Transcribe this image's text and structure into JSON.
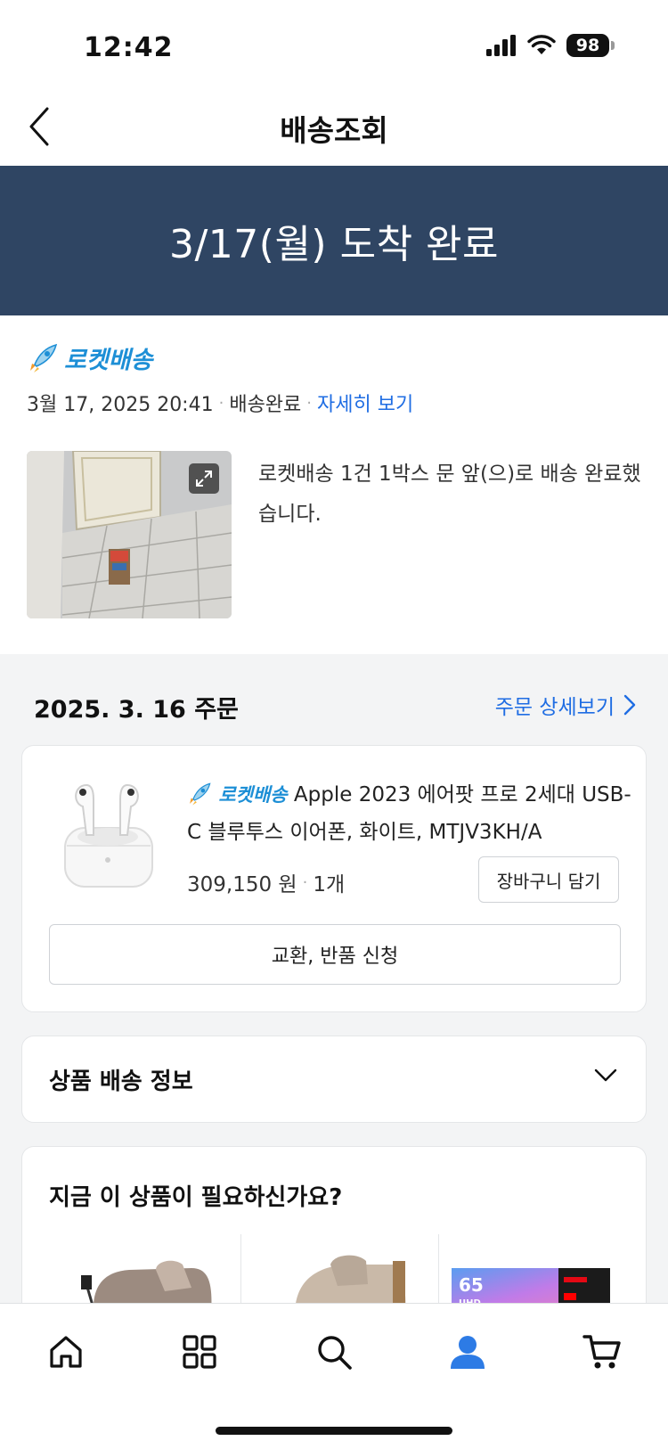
{
  "status_bar": {
    "time": "12:42",
    "battery": "98"
  },
  "header": {
    "title": "배송조회"
  },
  "banner": {
    "arrival": "3/17(월) 도착 완료"
  },
  "delivery": {
    "brand": "로켓배송",
    "datetime": "3월 17, 2025 20:41",
    "status": "배송완료",
    "detail_link": "자세히 보기",
    "message": "로켓배송 1건 1박스 문 앞(으)로 배송 완료했습니다."
  },
  "order": {
    "date": "2025. 3. 16 주문",
    "detail_link": "주문 상세보기",
    "product": {
      "brand": "로켓배송",
      "name": "Apple 2023 에어팟 프로 2세대 USB-C 블루투스 이어폰, 화이트, MTJV3KH/A",
      "price": "309,150 원",
      "quantity": "1개",
      "cart_button": "장바구니 담기",
      "return_button": "교환, 반품 신청"
    }
  },
  "shipping_info": {
    "title": "상품 배송 정보"
  },
  "recommendations": {
    "title": "지금 이 상품이 필요하신가요?"
  },
  "tabs": [
    "home-icon",
    "category-icon",
    "search-icon",
    "my-account-icon",
    "cart-icon"
  ],
  "colors": {
    "banner": "#2f4563",
    "link": "#1f6de3",
    "rocket": "#1d8fd6",
    "active_tab": "#2d7be5"
  }
}
